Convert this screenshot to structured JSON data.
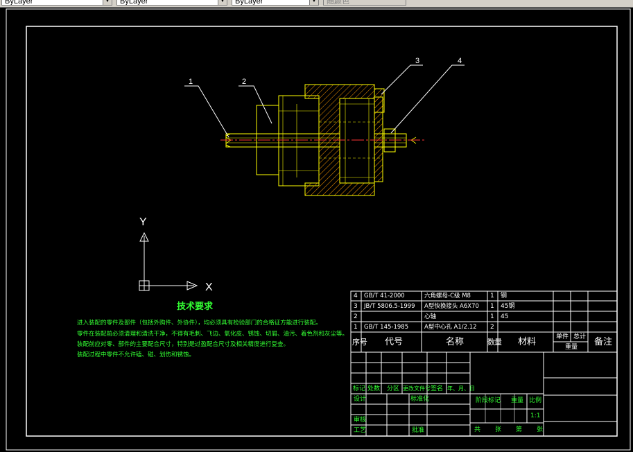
{
  "toolbar": {
    "color_combo": "ByLayer",
    "linetype_combo": "ByLayer",
    "lineweight_combo": "ByLayer",
    "plotstyle_combo": "随颜色"
  },
  "colors": {
    "background": "#000000",
    "frame": "#ffffff",
    "part_outline": "#ffff00",
    "hatch": "#ff9900",
    "center_line": "#ff3333",
    "notes": "#33ff33"
  },
  "balloons": [
    "1",
    "2",
    "3",
    "4"
  ],
  "ucs_icon": {
    "x_label": "X",
    "y_label": "Y"
  },
  "notes": {
    "title": "技术要求",
    "lines": [
      "进入装配的零件及部件（包括外购件、外协件），均必须具有检验部门的合格证方能进行装配。",
      "零件在装配前必须清理和清洗干净，不得有毛刺、飞边、氧化皮、锈蚀、切屑、油污、着色剂和灰尘等。",
      "装配前应对零、部件的主要配合尺寸，特别是过盈配合尺寸及相关精度进行复查。",
      "装配过程中零件不允许磕、碰、划伤和锈蚀。"
    ]
  },
  "parts_list": {
    "rows": [
      {
        "no": "4",
        "code": "GB/T 41-2000",
        "name": "六角螺母-C级 M8",
        "qty": "1",
        "material": "钢"
      },
      {
        "no": "3",
        "code": "JB/T 5806.5-1999",
        "name": "A型快换接头 A6X70",
        "qty": "1",
        "material": "45钢"
      },
      {
        "no": "2",
        "code": "",
        "name": "心轴",
        "qty": "1",
        "material": "45"
      },
      {
        "no": "1",
        "code": "GB/T 145-1985",
        "name": "A型中心孔 A1/2.12",
        "qty": "2",
        "material": ""
      }
    ],
    "header": {
      "no": "序号",
      "code": "代号",
      "name": "名称",
      "qty": "数量",
      "material": "材料",
      "unit": "单件",
      "total": "总计",
      "weight": "重量",
      "remark": "备注"
    }
  },
  "title_block": {
    "rev_headers": [
      "标记",
      "处数",
      "分区",
      "更改文件号",
      "签名",
      "年、月、日"
    ],
    "design": "设计",
    "standardize": "标准化",
    "review": "审核",
    "process": "工艺",
    "approve": "批准",
    "stage_mark": "阶段标记",
    "weight": "重量",
    "scale": "比例",
    "scale_value": "1:1",
    "sheets": "共　张　第　张"
  }
}
